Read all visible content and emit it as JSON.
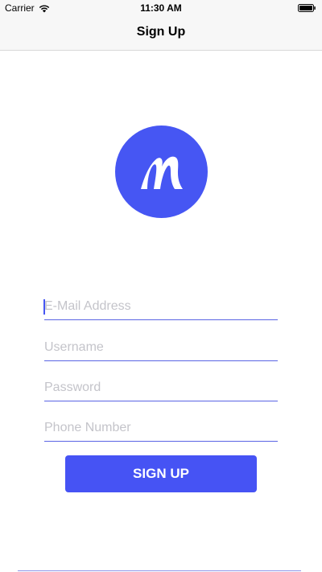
{
  "status_bar": {
    "carrier": "Carrier",
    "time": "11:30 AM"
  },
  "nav": {
    "title": "Sign Up"
  },
  "logo": {
    "icon": "logo-m-icon",
    "color": "#4656f3"
  },
  "form": {
    "email_placeholder": "E-Mail Address",
    "username_placeholder": "Username",
    "password_placeholder": "Password",
    "phone_placeholder": "Phone Number",
    "email_value": "",
    "username_value": "",
    "password_value": "",
    "phone_value": ""
  },
  "signup_button": {
    "label": "SIGN UP",
    "color": "#4653f4"
  },
  "colors": {
    "accent": "#4656f3",
    "underline": "#5a64e4",
    "placeholder": "#c4c4ca"
  }
}
